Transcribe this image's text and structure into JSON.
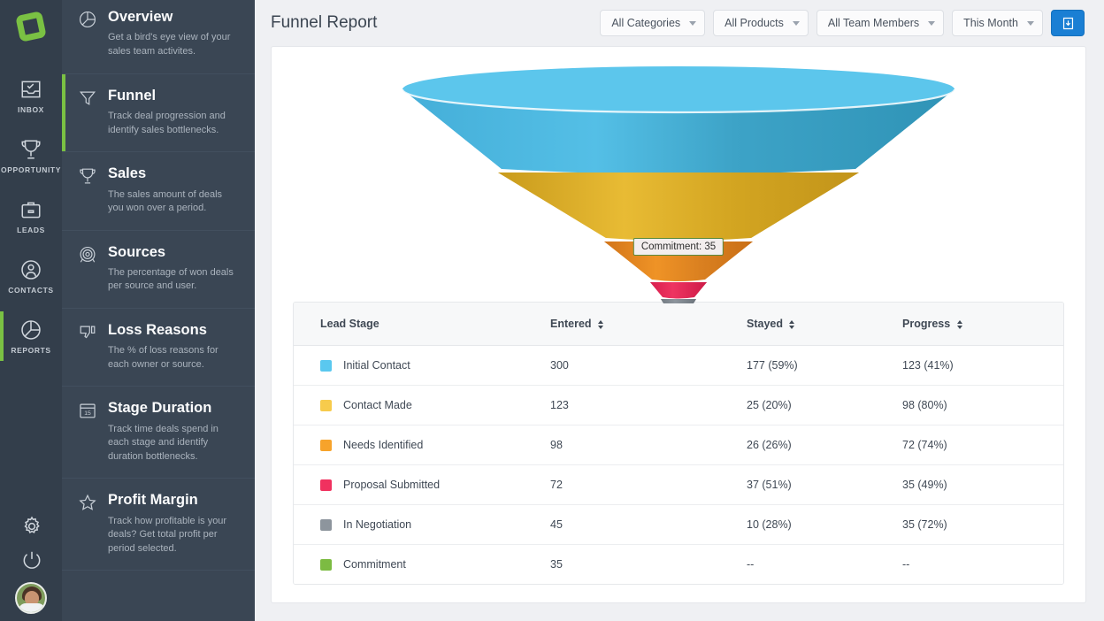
{
  "brand": {
    "logo_icon": "diamond-ring-logo",
    "accent": "#7ac143"
  },
  "rail": {
    "items": [
      {
        "label": "INBOX",
        "icon": "inbox-icon",
        "active": false
      },
      {
        "label": "OPPORTUNITY",
        "icon": "trophy-icon",
        "active": false
      },
      {
        "label": "LEADS",
        "icon": "briefcase-icon",
        "active": false
      },
      {
        "label": "CONTACTS",
        "icon": "contacts-icon",
        "active": false
      },
      {
        "label": "REPORTS",
        "icon": "pie-chart-icon",
        "active": true
      }
    ],
    "bottom": [
      {
        "label": "Settings",
        "icon": "gear-icon"
      },
      {
        "label": "Logout",
        "icon": "power-icon"
      }
    ],
    "avatar_name": "user-avatar"
  },
  "nav": {
    "items": [
      {
        "title": "Overview",
        "desc": "Get a bird's eye view of your sales team activites.",
        "icon": "pie-chart-icon",
        "active": false
      },
      {
        "title": "Funnel",
        "desc": "Track deal progression and identify sales bottlenecks.",
        "icon": "funnel-icon",
        "active": true
      },
      {
        "title": "Sales",
        "desc": "The sales amount of deals you won over a period.",
        "icon": "trophy-icon",
        "active": false
      },
      {
        "title": "Sources",
        "desc": "The percentage of won deals per source and user.",
        "icon": "target-icon",
        "active": false
      },
      {
        "title": "Loss Reasons",
        "desc": "The % of loss reasons for each owner or source.",
        "icon": "thumbs-down-icon",
        "active": false
      },
      {
        "title": "Stage Duration",
        "desc": "Track time deals spend in each stage and identify duration bottlenecks.",
        "icon": "calendar-icon",
        "active": false
      },
      {
        "title": "Profit Margin",
        "desc": "Track how profitable is your deals? Get total profit per period selected.",
        "icon": "star-icon",
        "active": false
      }
    ]
  },
  "header": {
    "title": "Funnel Report",
    "filters": [
      {
        "name": "categories-filter",
        "value": "All Categories"
      },
      {
        "name": "products-filter",
        "value": "All Products"
      },
      {
        "name": "team-filter",
        "value": "All Team Members"
      },
      {
        "name": "period-filter",
        "value": "This Month"
      }
    ],
    "export_icon": "download-icon",
    "export_color": "#1a7fd4"
  },
  "chart_data": {
    "type": "funnel",
    "title": "Funnel Report",
    "tooltip": "Commitment: 35",
    "categories": [
      "Initial Contact",
      "Contact Made",
      "Needs Identified",
      "Proposal Submitted",
      "In Negotiation",
      "Commitment"
    ],
    "values": [
      300,
      123,
      98,
      72,
      45,
      35
    ],
    "colors": [
      "#4fc0e8",
      "#f5c344",
      "#f5a227",
      "#ec4168",
      "#8d959d",
      "#7ab844"
    ],
    "legend_position": "table-below",
    "grid": false
  },
  "table": {
    "columns": [
      {
        "label": "Lead Stage",
        "sortable": false
      },
      {
        "label": "Entered",
        "sortable": true
      },
      {
        "label": "Stayed",
        "sortable": true
      },
      {
        "label": "Progress",
        "sortable": true
      }
    ],
    "rows": [
      {
        "color": "#5ac8ef",
        "stage": "Initial Contact",
        "entered": "300",
        "stayed": "177 (59%)",
        "progress": "123 (41%)"
      },
      {
        "color": "#f7cb4c",
        "stage": "Contact Made",
        "entered": "123",
        "stayed": "25 (20%)",
        "progress": "98 (80%)"
      },
      {
        "color": "#f7a32b",
        "stage": "Needs Identified",
        "entered": "98",
        "stayed": "26 (26%)",
        "progress": "72 (74%)"
      },
      {
        "color": "#f0315f",
        "stage": "Proposal Submitted",
        "entered": "72",
        "stayed": "37 (51%)",
        "progress": "35 (49%)"
      },
      {
        "color": "#8d959d",
        "stage": "In Negotiation",
        "entered": "45",
        "stayed": "10 (28%)",
        "progress": "35 (72%)"
      },
      {
        "color": "#7cbb42",
        "stage": "Commitment",
        "entered": "35",
        "stayed": "--",
        "progress": "--"
      }
    ]
  }
}
